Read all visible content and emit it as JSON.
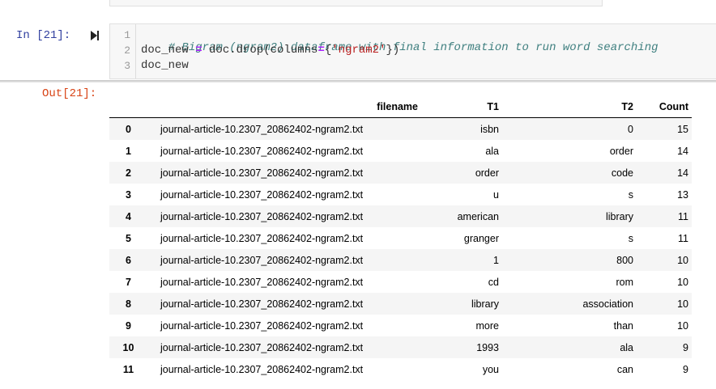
{
  "prompts": {
    "in": "In [21]:",
    "out": "Out[21]:"
  },
  "code": {
    "line_numbers": [
      "1",
      "2",
      "3"
    ],
    "line1_comment": "# Bigram (ngram2) dataframe with final information to run word searching",
    "line2": {
      "lhs": "doc_new ",
      "eq": "=",
      "mid": " doc.drop(columns",
      "eq2": "=",
      "brace_open": "{",
      "str": "'ngram2'",
      "brace_close": "})"
    },
    "line3": "doc_new"
  },
  "table": {
    "columns": [
      "filename",
      "T1",
      "T2",
      "Count"
    ],
    "rows": [
      {
        "idx": "0",
        "filename": "journal-article-10.2307_20862402-ngram2.txt",
        "t1": "isbn",
        "t2": "0",
        "count": "15"
      },
      {
        "idx": "1",
        "filename": "journal-article-10.2307_20862402-ngram2.txt",
        "t1": "ala",
        "t2": "order",
        "count": "14"
      },
      {
        "idx": "2",
        "filename": "journal-article-10.2307_20862402-ngram2.txt",
        "t1": "order",
        "t2": "code",
        "count": "14"
      },
      {
        "idx": "3",
        "filename": "journal-article-10.2307_20862402-ngram2.txt",
        "t1": "u",
        "t2": "s",
        "count": "13"
      },
      {
        "idx": "4",
        "filename": "journal-article-10.2307_20862402-ngram2.txt",
        "t1": "american",
        "t2": "library",
        "count": "11"
      },
      {
        "idx": "5",
        "filename": "journal-article-10.2307_20862402-ngram2.txt",
        "t1": "granger",
        "t2": "s",
        "count": "11"
      },
      {
        "idx": "6",
        "filename": "journal-article-10.2307_20862402-ngram2.txt",
        "t1": "1",
        "t2": "800",
        "count": "10"
      },
      {
        "idx": "7",
        "filename": "journal-article-10.2307_20862402-ngram2.txt",
        "t1": "cd",
        "t2": "rom",
        "count": "10"
      },
      {
        "idx": "8",
        "filename": "journal-article-10.2307_20862402-ngram2.txt",
        "t1": "library",
        "t2": "association",
        "count": "10"
      },
      {
        "idx": "9",
        "filename": "journal-article-10.2307_20862402-ngram2.txt",
        "t1": "more",
        "t2": "than",
        "count": "10"
      },
      {
        "idx": "10",
        "filename": "journal-article-10.2307_20862402-ngram2.txt",
        "t1": "1993",
        "t2": "ala",
        "count": "9"
      },
      {
        "idx": "11",
        "filename": "journal-article-10.2307_20862402-ngram2.txt",
        "t1": "you",
        "t2": "can",
        "count": "9"
      }
    ]
  },
  "icons": {
    "run": "run-cell-icon"
  },
  "colors": {
    "in_prompt": "#303f9f",
    "out_prompt": "#d84315",
    "comment": "#408080",
    "string": "#ba2121",
    "operator": "#aa22ff"
  }
}
